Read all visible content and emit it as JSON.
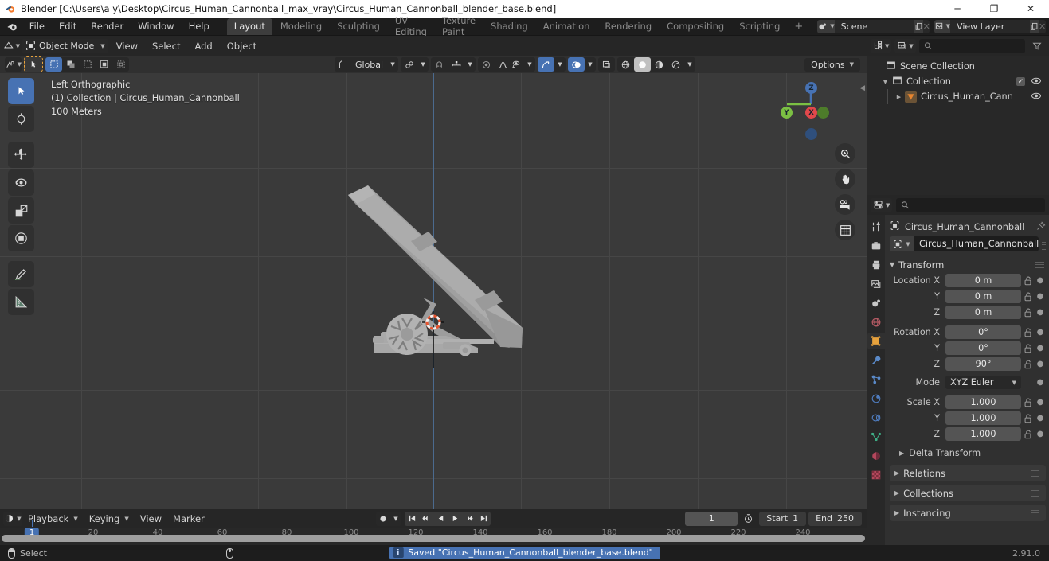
{
  "window": {
    "title": "Blender [C:\\Users\\a y\\Desktop\\Circus_Human_Cannonball_max_vray\\Circus_Human_Cannonball_blender_base.blend]",
    "minimize": "─",
    "maximize": "❐",
    "close": "✕"
  },
  "topbar": {
    "menus": [
      "File",
      "Edit",
      "Render",
      "Window",
      "Help"
    ],
    "workspaces": [
      {
        "label": "Layout",
        "active": true
      },
      {
        "label": "Modeling",
        "active": false
      },
      {
        "label": "Sculpting",
        "active": false
      },
      {
        "label": "UV Editing",
        "active": false
      },
      {
        "label": "Texture Paint",
        "active": false
      },
      {
        "label": "Shading",
        "active": false
      },
      {
        "label": "Animation",
        "active": false
      },
      {
        "label": "Rendering",
        "active": false
      },
      {
        "label": "Compositing",
        "active": false
      },
      {
        "label": "Scripting",
        "active": false
      }
    ],
    "add_workspace": "+",
    "scene": {
      "name": "Scene",
      "new_btn": "copy-icon",
      "unlink_btn": "✕"
    },
    "viewlayer": {
      "name": "View Layer",
      "new_btn": "copy-icon",
      "unlink_btn": "✕"
    }
  },
  "viewport": {
    "mode": "Object Mode",
    "menus": [
      "View",
      "Select",
      "Add",
      "Object"
    ],
    "transform_orientation": "Global",
    "options_label": "Options",
    "overlay_text": {
      "view": "Left Orthographic",
      "collection": "(1) Collection | Circus_Human_Cannonball",
      "scale": "100 Meters"
    },
    "gizmo_axes": [
      {
        "label": "Z",
        "color": "#4772b3"
      },
      {
        "label": "Y",
        "color": "#7bc043"
      },
      {
        "label": "X",
        "color": "#e0484b"
      }
    ],
    "tools": [
      {
        "name": "tweak-tool",
        "active": true
      },
      {
        "name": "cursor-tool",
        "active": false
      },
      {
        "name": "move-tool",
        "active": false
      },
      {
        "name": "rotate-tool",
        "active": false
      },
      {
        "name": "scale-tool",
        "active": false
      },
      {
        "name": "transform-tool",
        "active": false
      },
      {
        "name": "annotate-tool",
        "active": false
      },
      {
        "name": "measure-tool",
        "active": false
      }
    ],
    "nav_buttons": [
      "zoom-icon",
      "pan-hand-icon",
      "camera-icon",
      "grid-ortho-icon"
    ],
    "shading_modes": [
      "wireframe",
      "solid",
      "material-preview",
      "rendered"
    ],
    "active_shading": "solid"
  },
  "outliner": {
    "display_mode": "View Layer",
    "search_placeholder": "",
    "rows": [
      {
        "label": "Scene Collection",
        "indent": 0,
        "icon": "collection-icon",
        "disclosure": "",
        "checkbox": false,
        "eye": false
      },
      {
        "label": "Collection",
        "indent": 1,
        "icon": "collection-icon",
        "disclosure": "▼",
        "checkbox": true,
        "eye": true
      },
      {
        "label": "Circus_Human_Cann",
        "indent": 2,
        "icon": "object-icon",
        "disclosure": "▶",
        "checkbox": false,
        "eye": true
      }
    ]
  },
  "properties": {
    "search_placeholder": "",
    "breadcrumb": "Circus_Human_Cannonball",
    "object_name": "Circus_Human_Cannonball",
    "tabs": [
      {
        "name": "tool-tab",
        "active": false
      },
      {
        "name": "render-tab",
        "active": false
      },
      {
        "name": "output-tab",
        "active": false
      },
      {
        "name": "view-layer-tab",
        "active": false
      },
      {
        "name": "scene-tab",
        "active": false
      },
      {
        "name": "world-tab",
        "active": false
      },
      {
        "name": "object-tab",
        "active": true
      },
      {
        "name": "modifier-tab",
        "active": false
      },
      {
        "name": "particles-tab",
        "active": false
      },
      {
        "name": "physics-tab",
        "active": false
      },
      {
        "name": "constraints-tab",
        "active": false
      },
      {
        "name": "object-data-tab",
        "active": false
      },
      {
        "name": "material-tab",
        "active": false
      },
      {
        "name": "texture-tab",
        "active": false
      }
    ],
    "transform_panel": "Transform",
    "fields": [
      {
        "label": "Location X",
        "value": "0 m"
      },
      {
        "label": "Y",
        "value": "0 m"
      },
      {
        "label": "Z",
        "value": "0 m"
      },
      {
        "label": "Rotation X",
        "value": "0°"
      },
      {
        "label": "Y",
        "value": "0°"
      },
      {
        "label": "Z",
        "value": "90°"
      }
    ],
    "mode_label": "Mode",
    "mode_value": "XYZ Euler",
    "scale_fields": [
      {
        "label": "Scale X",
        "value": "1.000"
      },
      {
        "label": "Y",
        "value": "1.000"
      },
      {
        "label": "Z",
        "value": "1.000"
      }
    ],
    "sub_panels": [
      "Delta Transform"
    ],
    "panels": [
      "Relations",
      "Collections",
      "Instancing"
    ]
  },
  "timeline": {
    "editor_type": "timeline-icon",
    "menus": [
      "Playback",
      "Keying",
      "View",
      "Marker"
    ],
    "current_frame": "1",
    "start_label": "Start",
    "start_value": "1",
    "end_label": "End",
    "end_value": "250",
    "playhead_frame": "1",
    "ticks": [
      "20",
      "40",
      "60",
      "80",
      "100",
      "120",
      "140",
      "160",
      "180",
      "200",
      "220",
      "240"
    ]
  },
  "status": {
    "keymap": [
      {
        "mouse": "left",
        "label": "Select"
      },
      {
        "mouse": "mid",
        "label": ""
      },
      {
        "mouse": "right",
        "label": ""
      }
    ],
    "report": "Saved \"Circus_Human_Cannonball_blender_base.blend\"",
    "version": "2.91.0"
  }
}
